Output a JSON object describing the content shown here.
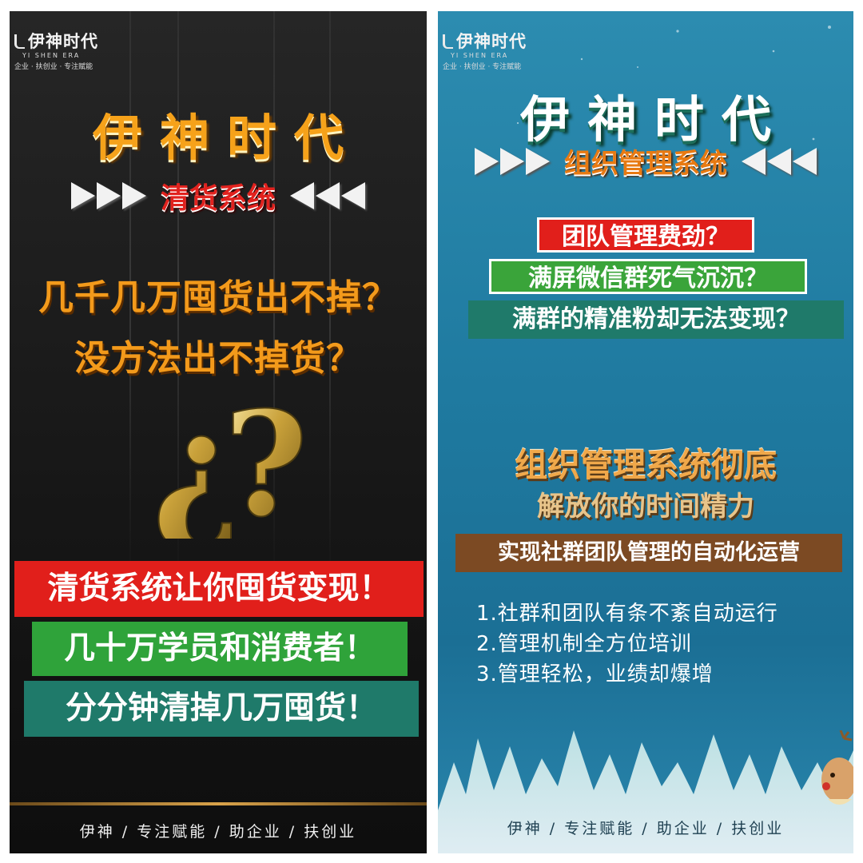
{
  "colors": {
    "left_bg": "#1a1a1a",
    "right_bg": "#1f7aa0",
    "red_band": "#e11f1b",
    "green_band": "#2fa33a",
    "teal_band": "#1f7a6a",
    "brown_band": "#7c4a23",
    "orange_text": "#f39a1b",
    "gold": "#c9a13a"
  },
  "left_poster": {
    "logo": {
      "name": "伊神时代",
      "english": "YI SHEN ERA",
      "tagline": "企业 · 扶创业 · 专注赋能"
    },
    "title": "伊神时代",
    "subtitle": "清货系统",
    "questions": [
      "几千几万囤货出不掉？",
      "没方法出不掉货？"
    ],
    "question_mark_icon": "gold-question-marks-icon",
    "bands": [
      "清货系统让你囤货变现！",
      "几十万学员和消费者！",
      "分分钟清掉几万囤货！"
    ],
    "footer": "伊神 / 专注赋能 / 助企业 / 扶创业"
  },
  "right_poster": {
    "logo": {
      "name": "伊神时代",
      "english": "YI SHEN ERA",
      "tagline": "企业 · 扶创业 · 专注赋能"
    },
    "title": "伊神时代",
    "subtitle": "组织管理系统",
    "questions": [
      "团队管理费劲？",
      "满屏微信群死气沉沉？",
      "满群的精准粉却无法变现？"
    ],
    "headline": "组织管理系统彻底",
    "headline_sub": "解放你的时间精力",
    "band": "实现社群团队管理的自动化运营",
    "list": [
      "1.社群和团队有条不紊自动运行",
      "2.管理机制全方位培训",
      "3.管理轻松，业绩却爆增"
    ],
    "footer": "伊神 / 专注赋能 / 助企业 / 扶创业"
  }
}
